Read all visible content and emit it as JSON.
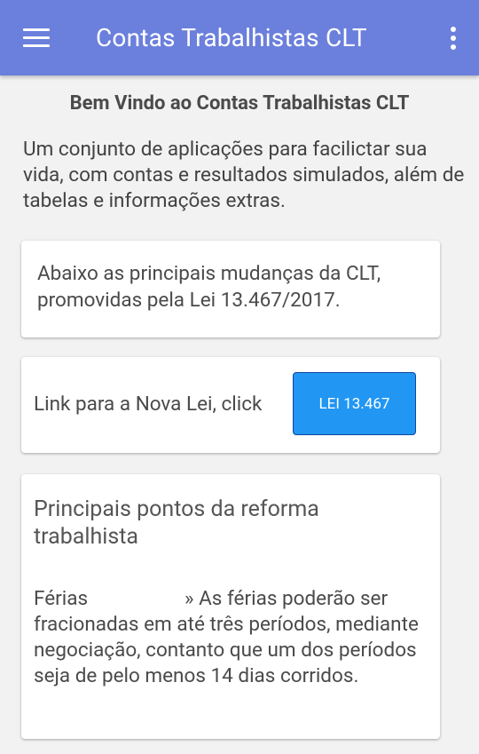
{
  "appbar": {
    "title": "Contas Trabalhistas CLT",
    "menu_icon": "hamburger-menu-icon",
    "overflow_icon": "more-vertical-icon",
    "color": "#6b7fdc"
  },
  "welcome": "Bem Vindo ao Contas Trabalhistas CLT",
  "intro": "Um conjunto de aplicações para facilictar sua vida, com contas e resultados simulados, além de tabelas e informações extras.",
  "card1": {
    "text": "Abaixo as principais mudanças da CLT, promovidas pela Lei 13.467/2017."
  },
  "card2": {
    "label": "Link para a Nova Lei, click",
    "button": "LEI 13.467",
    "button_color": "#2196f3"
  },
  "card3": {
    "heading": "Principais pontos da reforma trabalhista",
    "feature_title": "Férias",
    "feature_text": "» As férias poderão ser fracionadas em até três períodos, mediante negociação, contanto que um dos períodos seja de pelo menos 14 dias corridos."
  }
}
